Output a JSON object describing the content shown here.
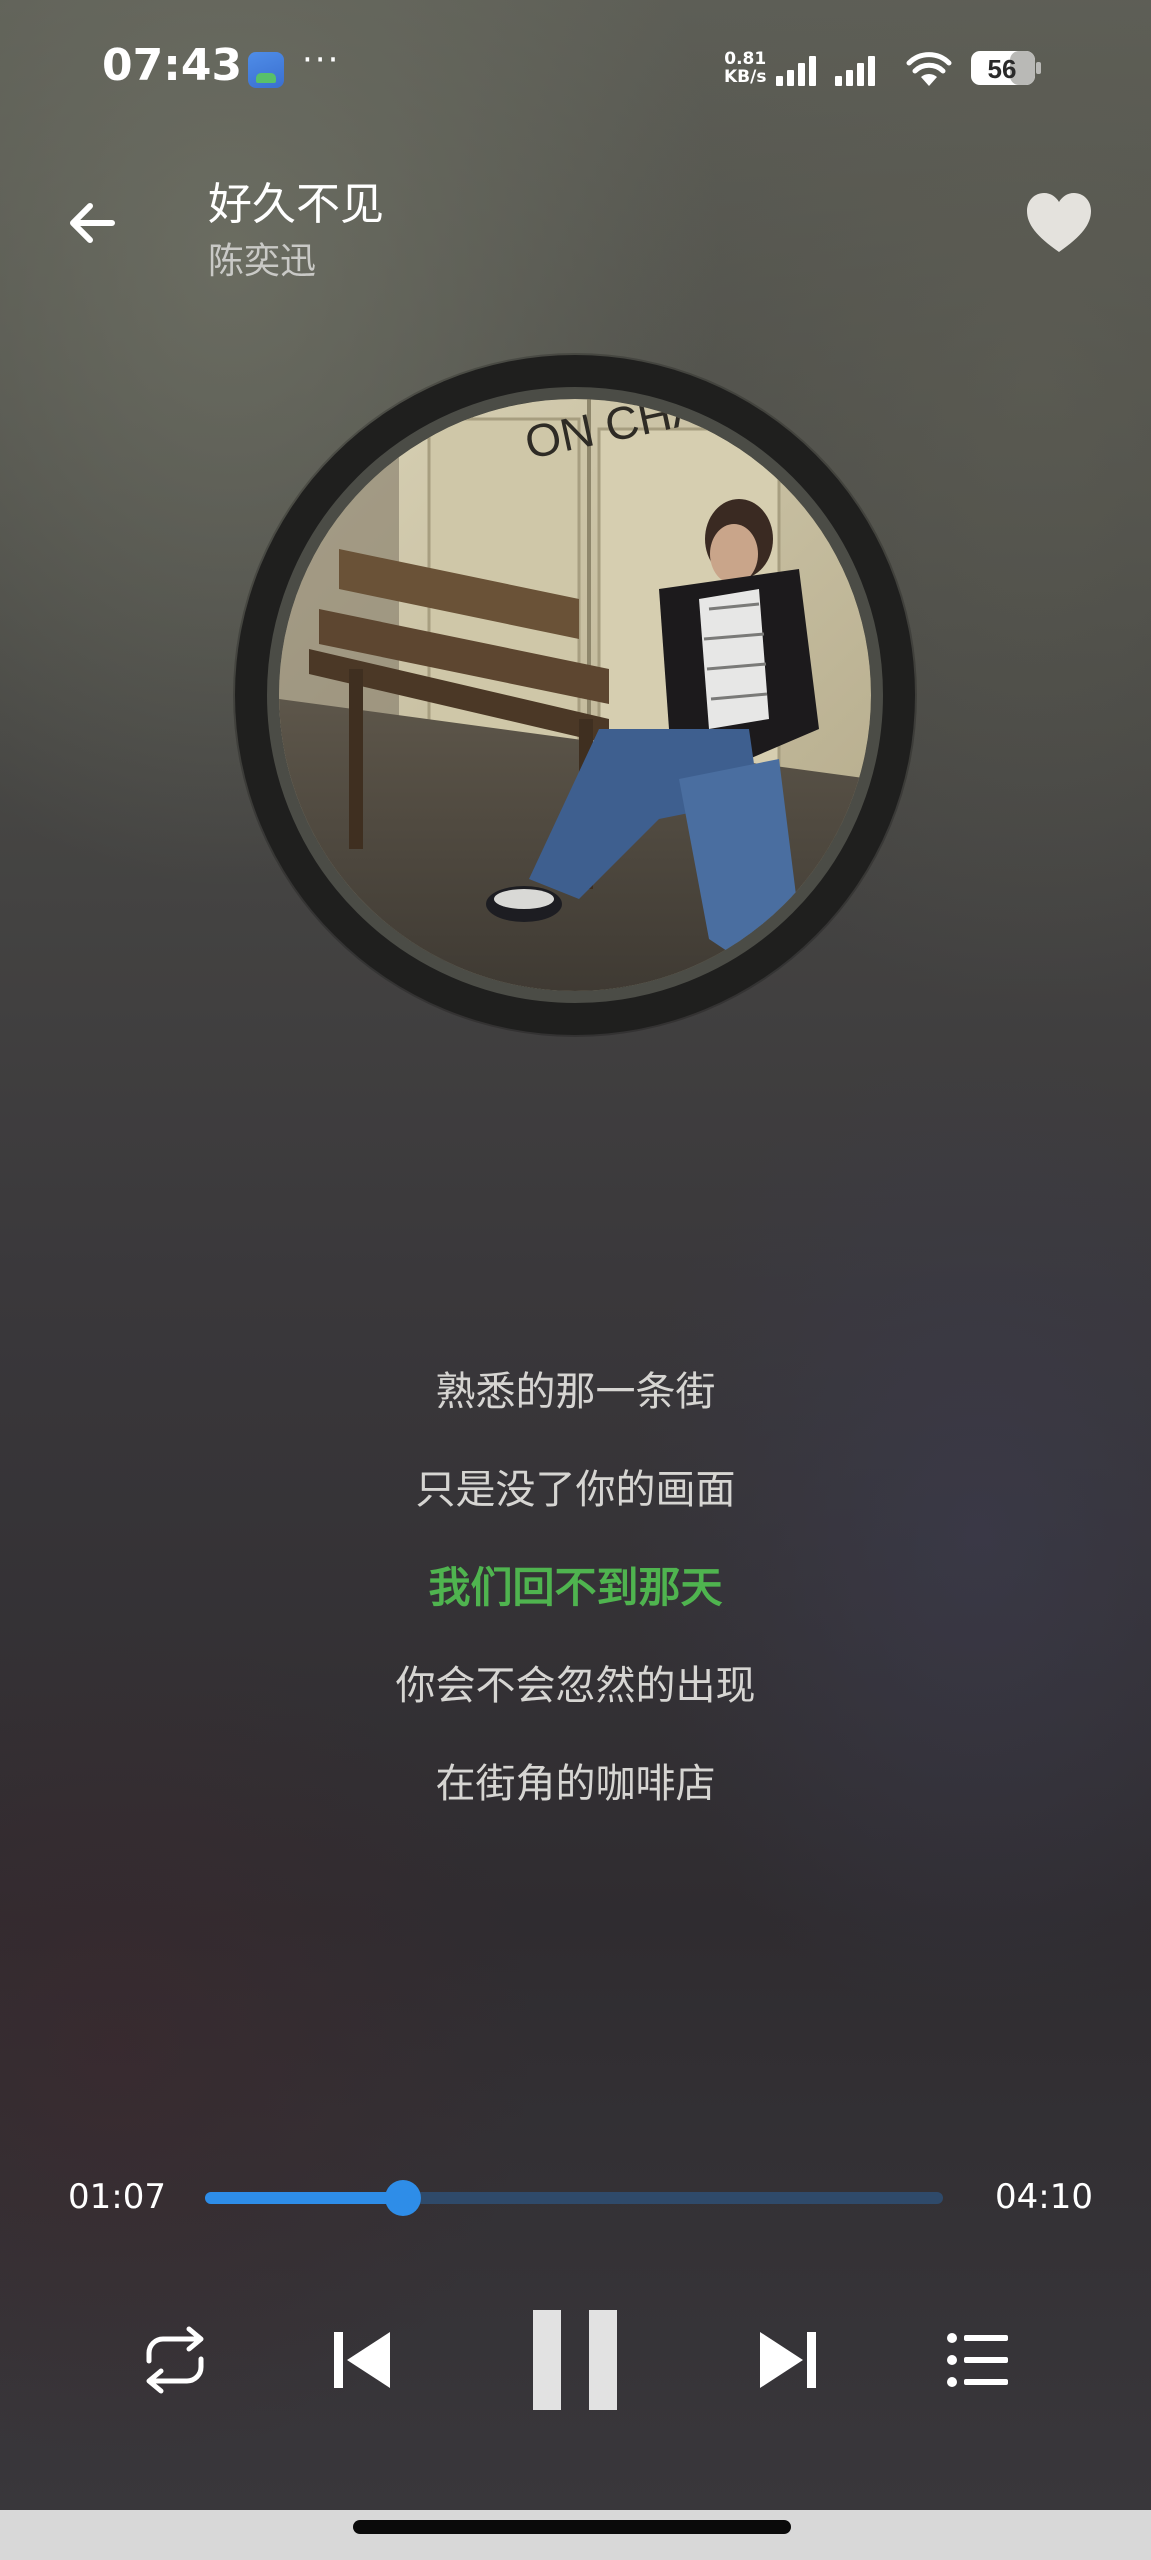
{
  "status_bar": {
    "time": "07:43",
    "more": "···",
    "net_speed_value": "0.81",
    "net_speed_unit": "KB/s",
    "battery": "56"
  },
  "header": {
    "title": "好久不见",
    "artist": "陈奕迅",
    "favorited": true
  },
  "album": {
    "art_text": "ON CHAN"
  },
  "lyrics": [
    {
      "text": "熟悉的那一条街",
      "active": false
    },
    {
      "text": "只是没了你的画面",
      "active": false
    },
    {
      "text": "我们回不到那天",
      "active": true
    },
    {
      "text": "你会不会忽然的出现",
      "active": false
    },
    {
      "text": "在街角的咖啡店",
      "active": false
    }
  ],
  "player": {
    "current_time": "01:07",
    "total_time": "04:10",
    "progress": 0.268,
    "state": "playing"
  },
  "colors": {
    "accent": "#2e8de8",
    "lyric_active": "#4fb44f",
    "lyric_inactive": "#d6d5d2"
  },
  "icons": {
    "back": "arrow-left-icon",
    "favorite": "heart-icon",
    "repeat": "repeat-icon",
    "previous": "skip-previous-icon",
    "play_pause": "pause-icon",
    "next": "skip-next-icon",
    "playlist": "playlist-icon"
  }
}
